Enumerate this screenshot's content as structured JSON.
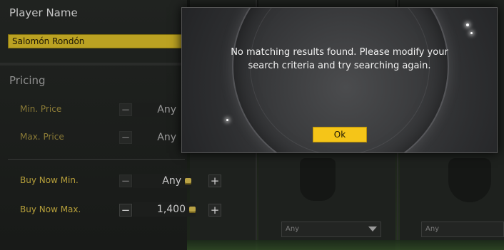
{
  "search": {
    "player_name_heading": "Player Name",
    "player_name_value": "Salomón Rondón",
    "pricing_heading": "Pricing",
    "rows": [
      {
        "label": "Min. Price",
        "value": "Any"
      },
      {
        "label": "Max. Price",
        "value": "Any"
      },
      {
        "label": "Buy Now Min.",
        "value": "Any"
      },
      {
        "label": "Buy Now Max.",
        "value": "1,400"
      }
    ],
    "dropdowns": [
      "Any",
      "Any"
    ]
  },
  "dialog": {
    "message_line1": "No matching results found. Please modify your",
    "message_line2": "search criteria and try searching again.",
    "ok_label": "Ok"
  },
  "icons": {
    "decrement": "minus-icon",
    "increment": "plus-icon",
    "coin": "coin-icon",
    "dropdown": "chevron-down-icon"
  },
  "colors": {
    "accent": "#f5c518",
    "name_field": "#bba222",
    "label": "#b69f3a"
  }
}
